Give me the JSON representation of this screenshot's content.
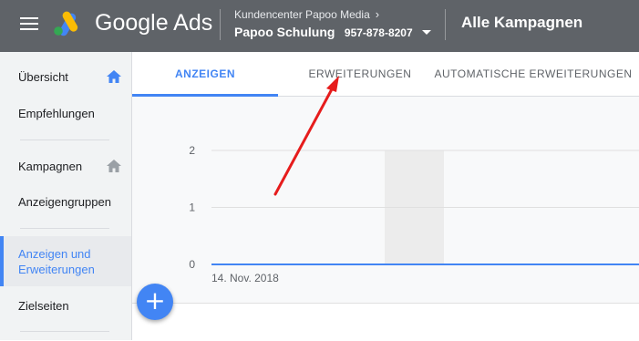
{
  "header": {
    "brand": "Google Ads",
    "manager_account": "Kundencenter Papoo Media",
    "account_name": "Papoo Schulung",
    "account_id": "957-878-8207",
    "page_title": "Alle Kampagnen",
    "bar_color": "#5f6368"
  },
  "sidebar": {
    "items": [
      {
        "label": "Übersicht",
        "icon": "home-icon"
      },
      {
        "label": "Empfehlungen"
      },
      {
        "label": "Kampagnen",
        "icon": "home-icon"
      },
      {
        "label": "Anzeigengruppen"
      },
      {
        "label": "Anzeigen und\nErweiterungen",
        "active": true
      },
      {
        "label": "Zielseiten"
      }
    ]
  },
  "tabs": [
    {
      "label": "ANZEIGEN",
      "active": true
    },
    {
      "label": "ERWEITERUNGEN"
    },
    {
      "label": "AUTOMATISCHE ERWEITERUNGEN"
    }
  ],
  "chart_data": {
    "type": "line",
    "y_ticks": [
      "2",
      "1",
      "0"
    ],
    "ylim": [
      0,
      2
    ],
    "x_start_label": "14. Nov. 2018",
    "series": [
      {
        "values": [
          0,
          0
        ]
      }
    ],
    "line_color": "#4285f4",
    "highlight_band": true
  },
  "fab": {
    "icon": "plus-icon",
    "color": "#4285f4"
  },
  "annotation": {
    "type": "red-arrow",
    "target": "tab-erweiterungen",
    "color": "#e61c1c"
  }
}
